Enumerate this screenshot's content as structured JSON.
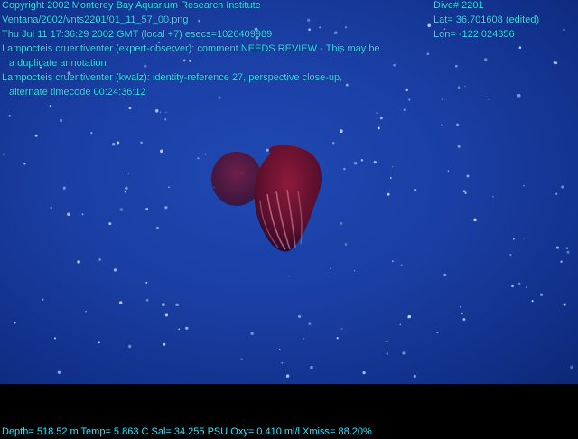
{
  "overlay": {
    "copyright": "Copyright 2002 Monterey Bay Aquarium Research Institute",
    "file_path": "Ventana/2002/vnts2201/01_11_57_00.png",
    "datetime": "Thu Jul 11 17:36:29 2002 GMT (local +7)  esecs=1026409989",
    "annotation1_line1": "Lampocteis cruentiventer (expert-observer): comment NEEDS REVIEW - This may be",
    "annotation1_line2": "a duplicate annotation",
    "annotation2_line1": "Lampocteis cruentiventer (kwalz): identity-reference 27, perspective close-up,",
    "annotation2_line2": "alternate timecode 00:24:36:12",
    "dive": "Dive# 2201",
    "lat": "Lat= 36.701608 (edited)",
    "lon": "Lon= -122.024856",
    "sensors": "Depth= 518.52 m  Temp= 5.863 C  Sal= 34.255 PSU  Oxy= 0.410 ml/l  Xmiss= 88.20%"
  },
  "colors": {
    "overlay_text": "#2ee6ff",
    "water": "#1a3ea3",
    "ctenophore": "#7a1030"
  }
}
